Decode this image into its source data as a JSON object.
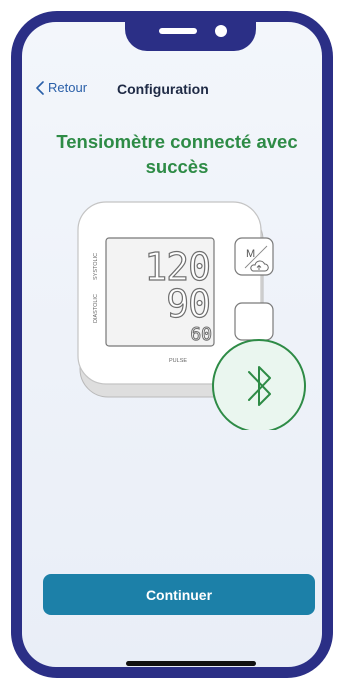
{
  "nav": {
    "back_label": "Retour",
    "title": "Configuration"
  },
  "main": {
    "headline": "Tensiomètre connecté avec succès",
    "device": {
      "systolic_value": "120",
      "diastolic_value": "90",
      "pulse_value": "60",
      "systolic_label": "SYSTOLIC",
      "diastolic_label": "DIASTOLIC",
      "pulse_label": "PULSE",
      "memory_button_label": "M"
    }
  },
  "footer": {
    "continue_label": "Continuer"
  },
  "icons": {
    "back": "chevron-left-icon",
    "bluetooth": "bluetooth-icon",
    "cloud": "cloud-upload-icon"
  },
  "colors": {
    "frame": "#2b2f86",
    "accent_green": "#2e8b46",
    "button_blue": "#1c80a8",
    "link_blue": "#2a5fa8"
  }
}
